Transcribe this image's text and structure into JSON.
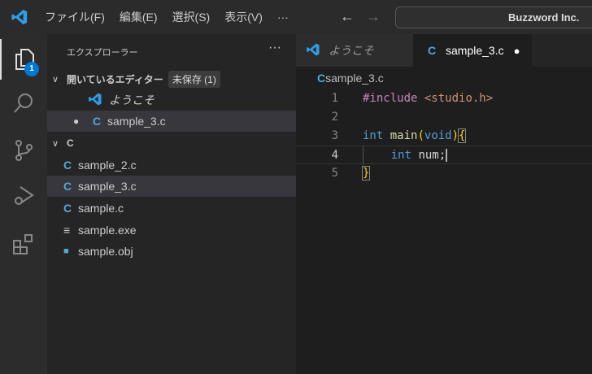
{
  "titlebar": {
    "menu": [
      "ファイル(F)",
      "編集(E)",
      "選択(S)",
      "表示(V)",
      "···"
    ],
    "back": "←",
    "forward": "→",
    "search": "Buzzword Inc."
  },
  "activity": {
    "badge": "1"
  },
  "explorer": {
    "title": "エクスプローラー",
    "more": "···",
    "open_editors": {
      "label": "開いているエディター",
      "unsaved": "未保存 (1)",
      "items": [
        {
          "name": "ようこそ"
        },
        {
          "name": "sample_3.c",
          "dirty": "●"
        }
      ]
    },
    "folder": {
      "label": "C",
      "files": [
        {
          "name": "sample_2.c",
          "icon": "C"
        },
        {
          "name": "sample_3.c",
          "icon": "C"
        },
        {
          "name": "sample.c",
          "icon": "C"
        },
        {
          "name": "sample.exe",
          "icon": "≡"
        },
        {
          "name": "sample.obj",
          "icon": "■"
        }
      ]
    }
  },
  "tabs": [
    {
      "label": "ようこそ"
    },
    {
      "label": "sample_3.c",
      "dirty": "●"
    }
  ],
  "breadcrumb": "sample_3.c",
  "code": {
    "lines": [
      "1",
      "2",
      "3",
      "4",
      "5"
    ],
    "l1a": "#include",
    "l1b": "<studio.h>",
    "l3a": "int",
    "l3b": "main",
    "l3c": "(",
    "l3d": "void",
    "l3e": ")",
    "l3f": "{",
    "l4a": "int",
    "l4b": "num;",
    "l5": "}"
  },
  "colors": {
    "accent": "#0078d4",
    "c_icon": "#4fa9d9"
  }
}
